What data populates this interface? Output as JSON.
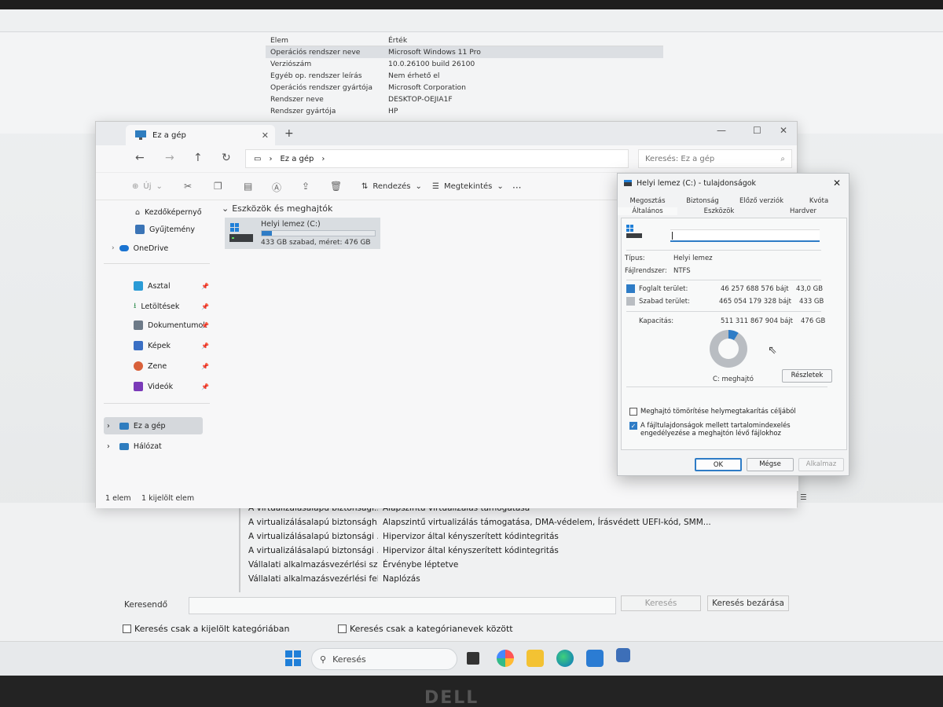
{
  "sysinfo": {
    "header": {
      "k": "Elem",
      "v": "Érték"
    },
    "rows": [
      {
        "k": "Operációs rendszer neve",
        "v": "Microsoft Windows 11 Pro"
      },
      {
        "k": "Verziószám",
        "v": "10.0.26100 build 26100"
      },
      {
        "k": "Egyéb op. rendszer leírás",
        "v": "Nem érhető el"
      },
      {
        "k": "Operációs rendszer gyártója",
        "v": "Microsoft Corporation"
      },
      {
        "k": "Rendszer neve",
        "v": "DESKTOP-OEJIA1F"
      },
      {
        "k": "Rendszer gyártója",
        "v": "HP"
      }
    ],
    "bottom_rows": [
      {
        "k": "A virtualizálásalapú biztonsági...",
        "v": "Alapszintű virtualizálás támogatása"
      },
      {
        "k": "A virtualizálásalapú biztonságh...",
        "v": "Alapszintű virtualizálás támogatása, DMA-védelem, Írásvédett UEFI-kód, SMM..."
      },
      {
        "k": "A virtualizálásalapú biztonsági ...",
        "v": "Hipervizor által kényszerített kódintegritás"
      },
      {
        "k": "A virtualizálásalapú biztonsági ...",
        "v": "Hipervizor által kényszerített kódintegritás"
      },
      {
        "k": "Vállalati alkalmazásvezérlési sz...",
        "v": "Érvénybe léptetve"
      },
      {
        "k": "Vállalati alkalmazásvezérlési fel...",
        "v": "Naplózás"
      }
    ],
    "search": {
      "label": "Keresendő",
      "find_button": "Keresés",
      "close_button": "Keresés bezárása",
      "check1": "Keresés csak a kijelölt kategóriában",
      "check2": "Keresés csak a kategórianevek között"
    }
  },
  "explorer": {
    "tab_title": "Ez a gép",
    "new_tab": "+",
    "breadcrumb": "Ez a gép",
    "search_placeholder": "Keresés: Ez a gép",
    "toolbar": {
      "new": "Új",
      "sort": "Rendezés",
      "view": "Megtekintés",
      "more": "···"
    },
    "nav": {
      "home": "Kezdőképernyő",
      "gallery": "Gyűjtemény",
      "onedrive": "OneDrive",
      "desktop": "Asztal",
      "downloads": "Letöltések",
      "documents": "Dokumentumok",
      "pictures": "Képek",
      "music": "Zene",
      "videos": "Videók",
      "this_pc": "Ez a gép",
      "network": "Hálózat"
    },
    "group_header": "Eszközök és meghajtók",
    "drive": {
      "name": "Helyi lemez (C:)",
      "free_text": "433 GB szabad, méret: 476 GB",
      "used_fraction": 0.09
    },
    "status": {
      "count": "1 elem",
      "selected": "1 kijelölt elem"
    }
  },
  "properties": {
    "title": "Helyi lemez (C:) - tulajdonságok",
    "tabs_row1": [
      "Megosztás",
      "Biztonság",
      "Előző verziók",
      "Kvóta"
    ],
    "tabs_row2": [
      "Általános",
      "Eszközök",
      "Hardver"
    ],
    "type_label": "Típus:",
    "type_value": "Helyi lemez",
    "fs_label": "Fájlrendszer:",
    "fs_value": "NTFS",
    "used_label": "Foglalt terület:",
    "used_bytes": "46 257 688 576 bájt",
    "used_gb": "43,0 GB",
    "free_label": "Szabad terület:",
    "free_bytes": "465 054 179 328 bájt",
    "free_gb": "433 GB",
    "cap_label": "Kapacitás:",
    "cap_bytes": "511 311 867 904 bájt",
    "cap_gb": "476 GB",
    "drive_label": "C: meghajtó",
    "details_button": "Részletek",
    "compress_label": "Meghajtó tömörítése helymegtakarítás céljából",
    "index_label": "A fájltulajdonságok mellett tartalomindexelés engedélyezése a meghajtón lévő fájlokhoz",
    "ok": "OK",
    "cancel": "Mégse",
    "apply": "Alkalmaz",
    "colors": {
      "used": "#2e7cc6",
      "free": "#b9bdc2"
    }
  },
  "taskbar": {
    "search_placeholder": "Keresés"
  },
  "brand": "DELL"
}
